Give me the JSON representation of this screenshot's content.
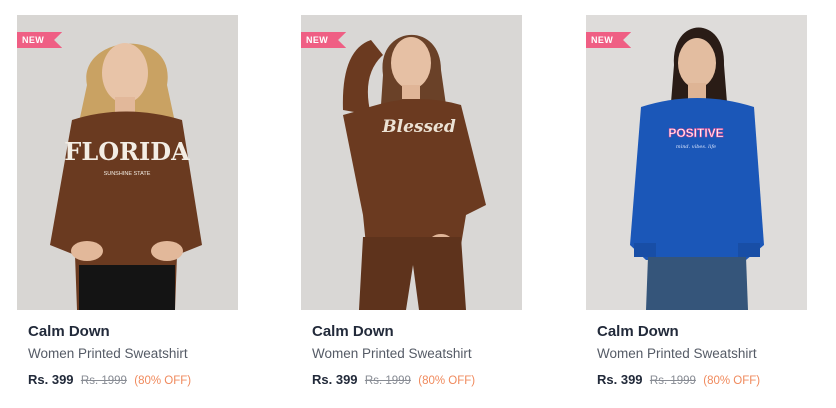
{
  "products": [
    {
      "badge": "NEW",
      "brand": "Calm Down",
      "name": "Women Printed Sweatshirt",
      "price": "Rs. 399",
      "mrp": "Rs. 1999",
      "discount": "(80% OFF)",
      "print_text": "FLORIDA",
      "print_subtext": "SUNSHINE STATE",
      "garment_color": "#6a3a20"
    },
    {
      "badge": "NEW",
      "brand": "Calm Down",
      "name": "Women Printed Sweatshirt",
      "price": "Rs. 399",
      "mrp": "Rs. 1999",
      "discount": "(80% OFF)",
      "print_text": "Blessed",
      "garment_color": "#6b3a20"
    },
    {
      "badge": "NEW",
      "brand": "Calm Down",
      "name": "Women Printed Sweatshirt",
      "price": "Rs. 399",
      "mrp": "Rs. 1999",
      "discount": "(80% OFF)",
      "print_text": "POSITIVE",
      "print_subtext": "mind. vibes. life",
      "garment_color": "#1b57b8"
    }
  ],
  "colors": {
    "badge": "#ef5f84",
    "discount": "#f08a5d",
    "brand_text": "#222a3a"
  }
}
